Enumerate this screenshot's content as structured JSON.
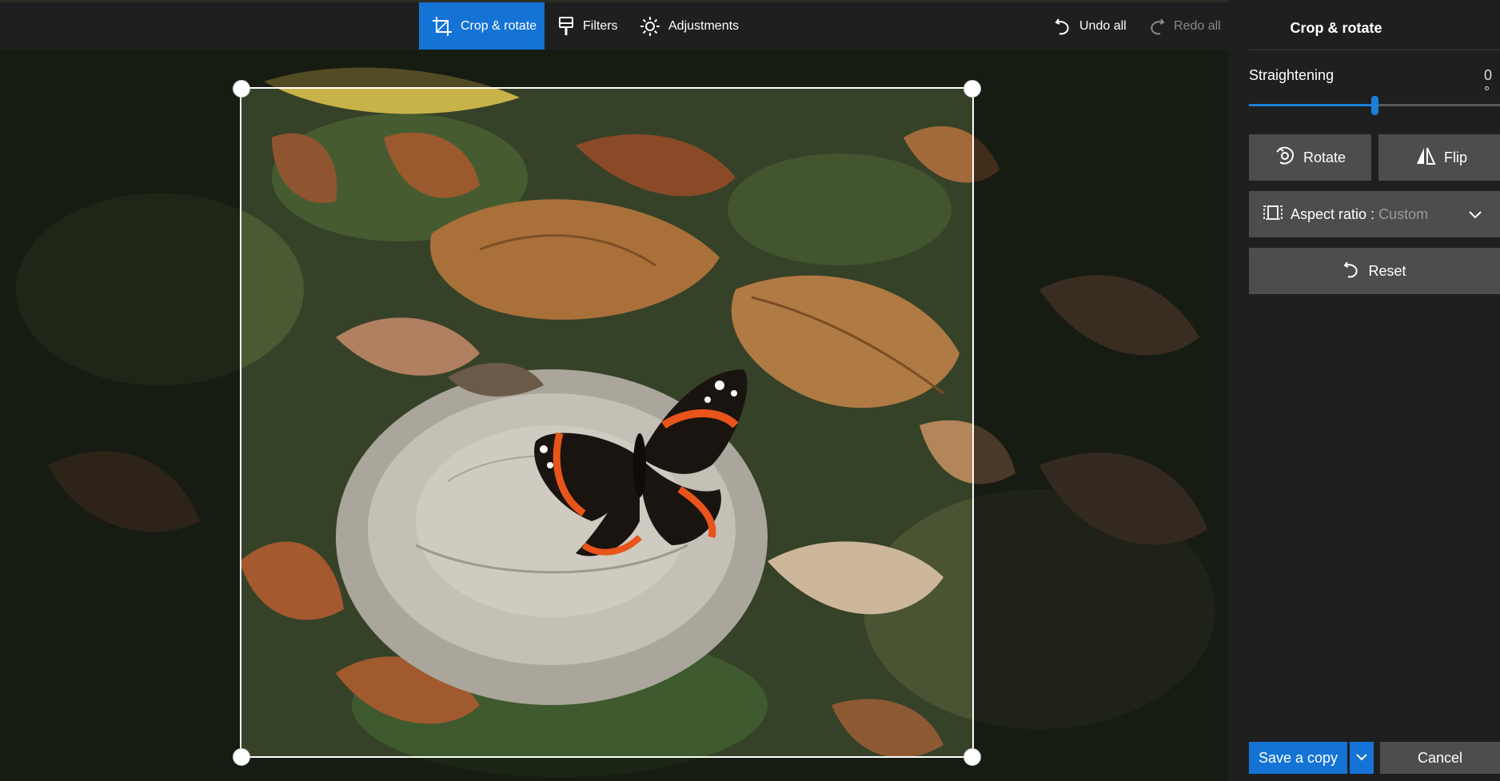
{
  "toolbar": {
    "tabs": [
      {
        "label": "Crop & rotate",
        "icon": "crop-icon",
        "active": true
      },
      {
        "label": "Filters",
        "icon": "brush-icon",
        "active": false
      },
      {
        "label": "Adjustments",
        "icon": "sun-icon",
        "active": false
      }
    ],
    "undo_label": "Undo all",
    "redo_label": "Redo all"
  },
  "panel": {
    "title": "Crop & rotate",
    "straightening_label": "Straightening",
    "straightening_value": "0 °",
    "straightening_level": 0.5,
    "rotate_label": "Rotate",
    "flip_label": "Flip",
    "aspect_label": "Aspect ratio : ",
    "aspect_value": "Custom",
    "reset_label": "Reset"
  },
  "footer": {
    "save_label": "Save a copy",
    "cancel_label": "Cancel"
  },
  "colors": {
    "accent": "#1473d4",
    "panel_bg": "#1f1f1f",
    "button_bg": "#4d4d4d"
  }
}
